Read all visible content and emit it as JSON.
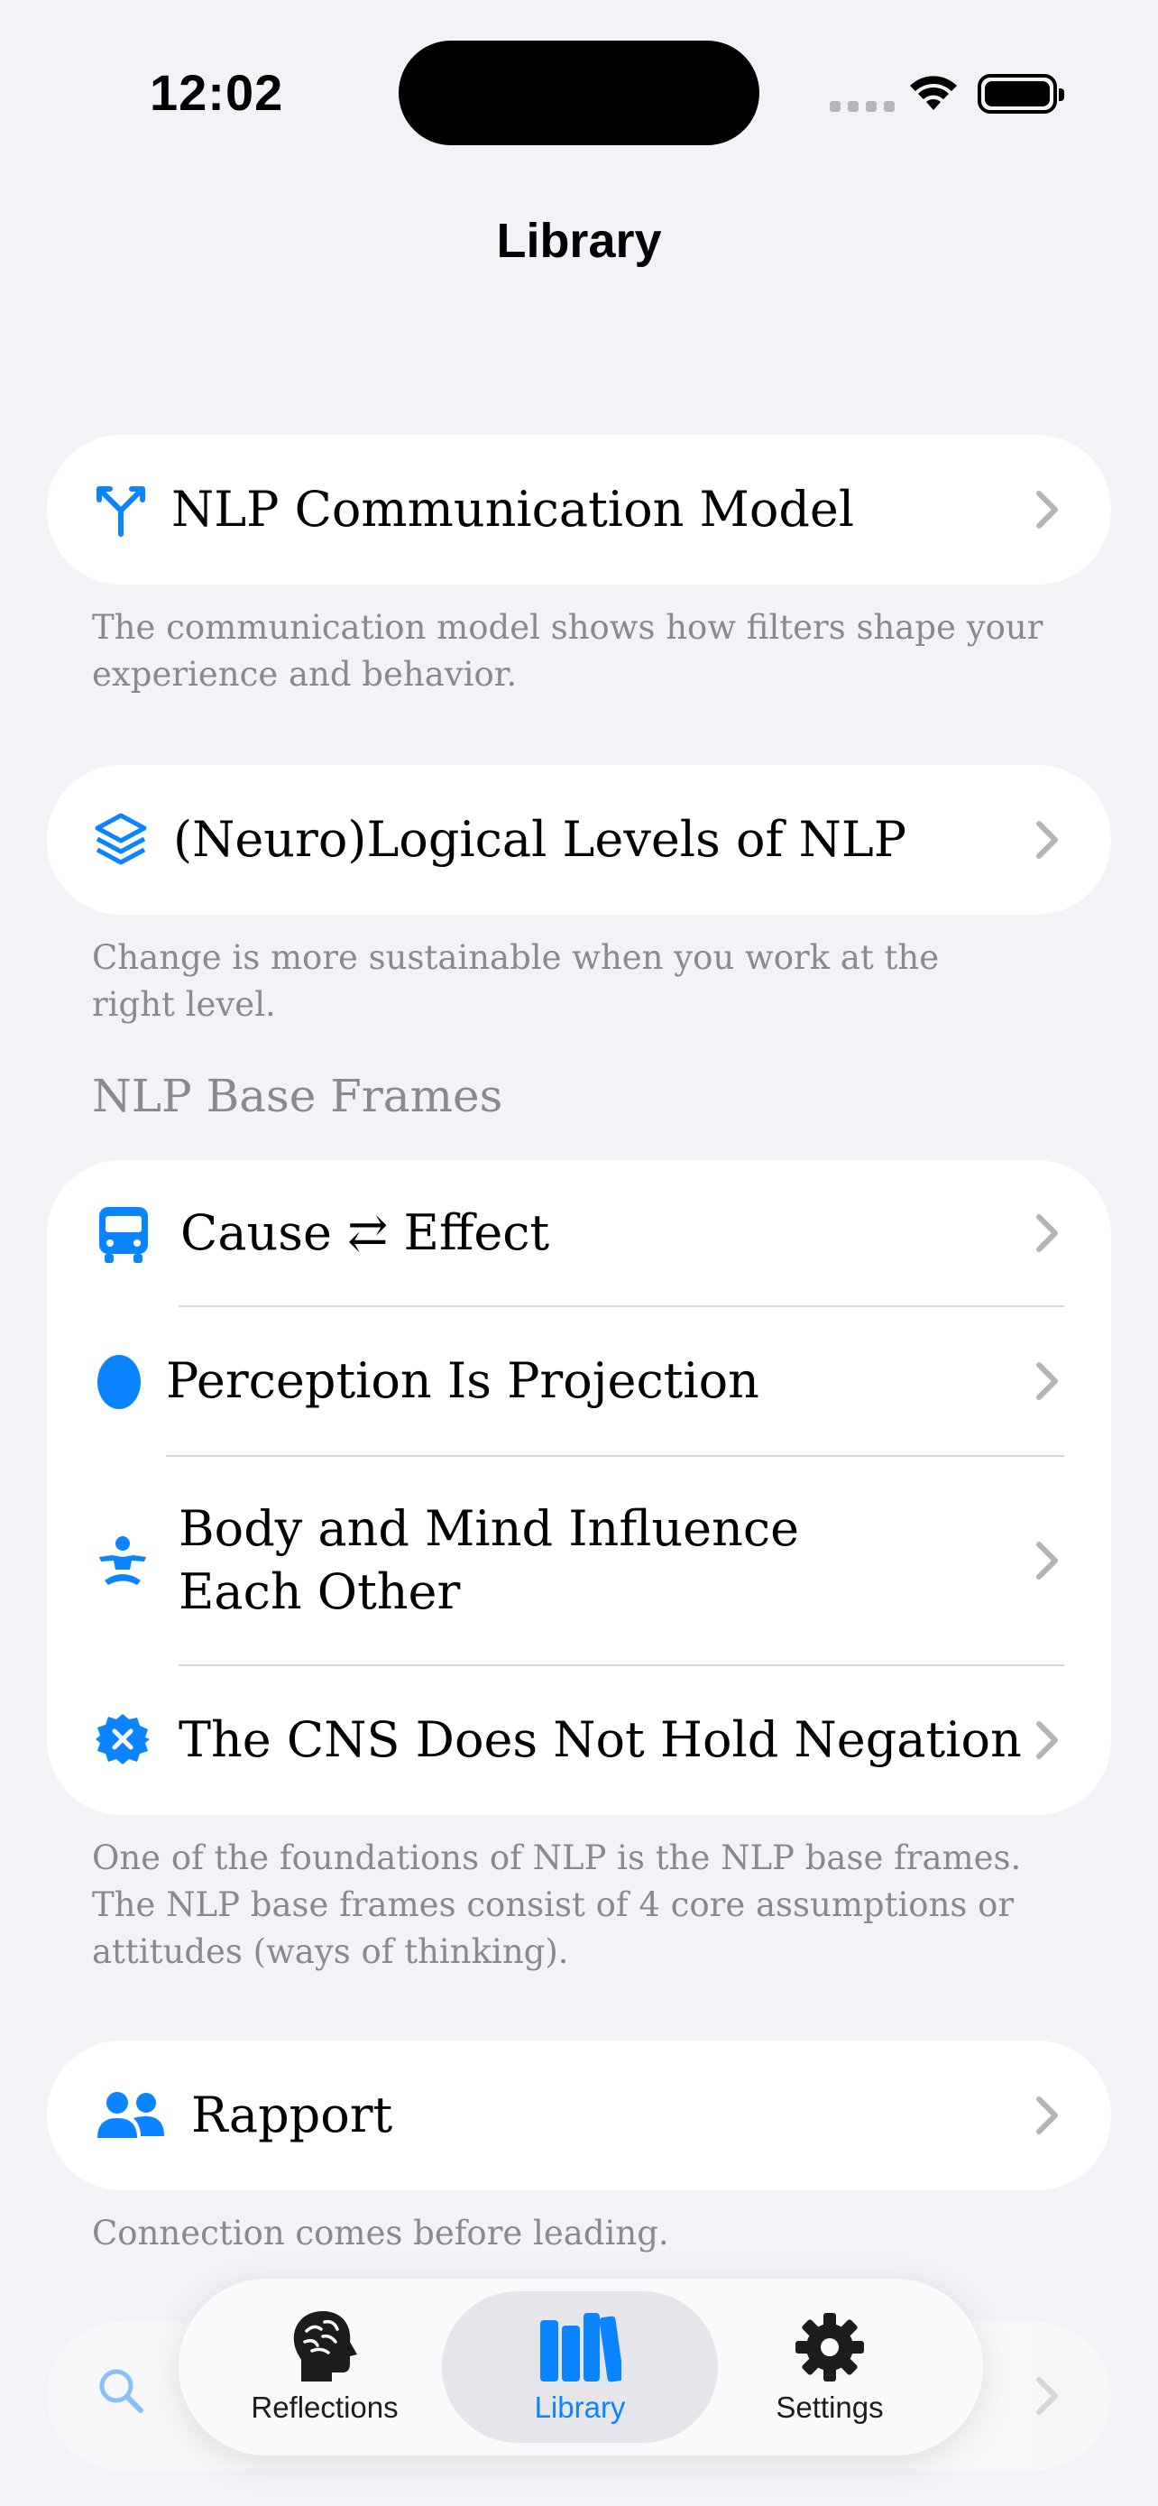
{
  "status_bar": {
    "time": "12:02"
  },
  "nav": {
    "title": "Library"
  },
  "colors": {
    "accent": "#0a84ff",
    "background": "#f2f2f7",
    "secondary_text": "#8a8a8e"
  },
  "library": {
    "communication_model": {
      "label": "NLP Communication Model",
      "icon": "fork-arrow-icon",
      "footnote": "The communication model shows how filters shape your experience and behavior."
    },
    "logical_levels": {
      "label": "(Neuro)Logical Levels of NLP",
      "icon": "layers-icon",
      "footnote": "Change is more sustainable when you work at the right level."
    },
    "base_frames": {
      "header": "NLP Base Frames",
      "items": [
        {
          "label": "Cause ⇄ Effect",
          "icon": "bus-icon"
        },
        {
          "label": "Perception Is Projection",
          "icon": "oval-icon"
        },
        {
          "label": "Body and Mind Influence Each Other",
          "icon": "figure-icon"
        },
        {
          "label": "The CNS Does Not Hold Negation",
          "icon": "xmark-seal-icon"
        }
      ],
      "footnote": "One of the foundations of NLP is the NLP base frames. The NLP base frames consist of 4 core assumptions or attitudes (ways of thinking)."
    },
    "rapport": {
      "label": "Rapport",
      "icon": "people-icon",
      "footnote": "Connection comes before leading."
    }
  },
  "tab_bar": {
    "tabs": [
      {
        "label": "Reflections",
        "icon": "brain-head-icon",
        "active": false
      },
      {
        "label": "Library",
        "icon": "books-icon",
        "active": true
      },
      {
        "label": "Settings",
        "icon": "gear-icon",
        "active": false
      }
    ]
  }
}
